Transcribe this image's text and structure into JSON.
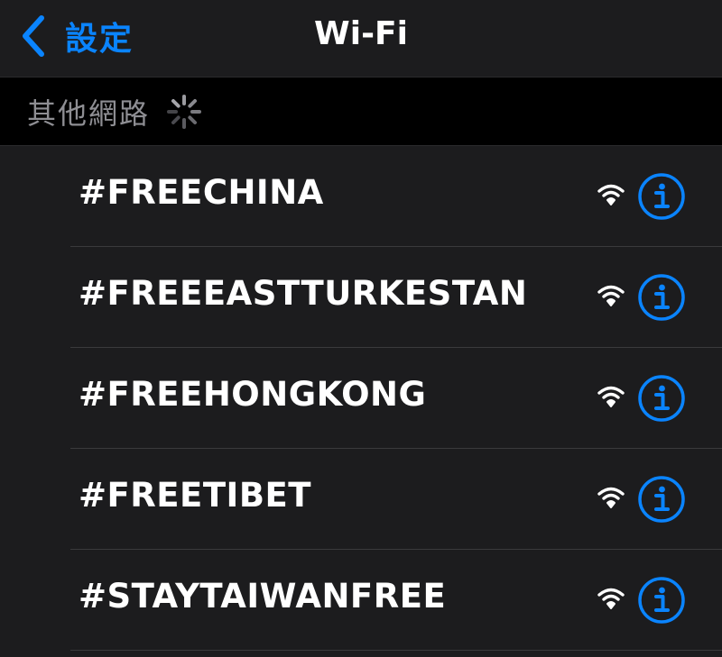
{
  "navbar": {
    "back_label": "設定",
    "back_icon": "chevron-left-icon",
    "title": "Wi-Fi"
  },
  "section": {
    "label": "其他網路",
    "loading_icon": "activity-spinner-icon"
  },
  "networks": [
    {
      "name": "#FREECHINA",
      "signal_icon": "wifi-icon",
      "info_icon": "info-icon"
    },
    {
      "name": "#FREEEASTTURKESTAN",
      "signal_icon": "wifi-icon",
      "info_icon": "info-icon"
    },
    {
      "name": "#FREEHONGKONG",
      "signal_icon": "wifi-icon",
      "info_icon": "info-icon"
    },
    {
      "name": "#FREETIBET",
      "signal_icon": "wifi-icon",
      "info_icon": "info-icon"
    },
    {
      "name": "#STAYTAIWANFREE",
      "signal_icon": "wifi-icon",
      "info_icon": "info-icon"
    }
  ],
  "colors": {
    "accent": "#0a84ff",
    "background": "#1c1c1e",
    "section_background": "#000000",
    "secondary_text": "#8e8e93",
    "separator": "#3a3a3c"
  }
}
